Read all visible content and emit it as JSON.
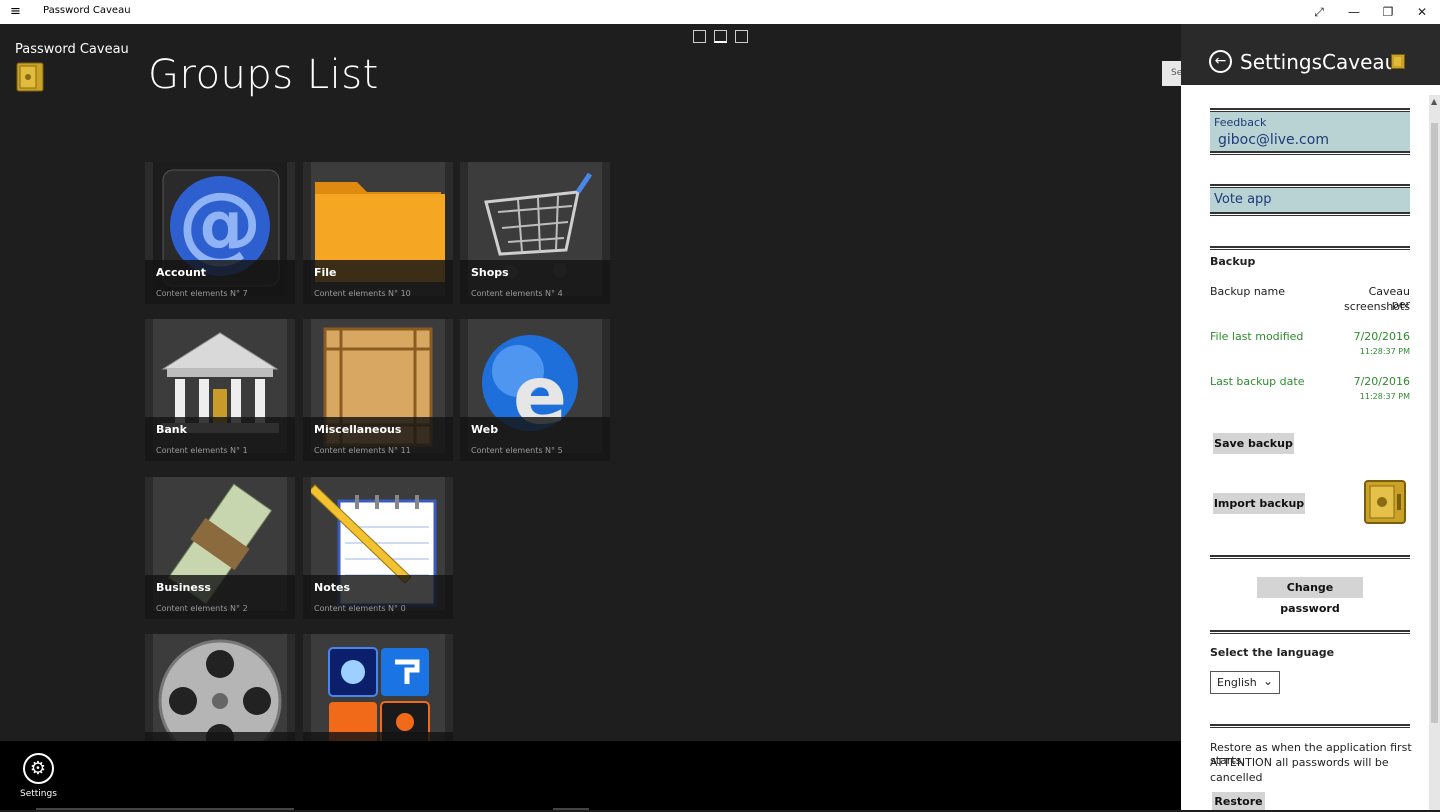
{
  "window": {
    "title": "Password Caveau",
    "menu_glyph": "≡",
    "controls": [
      "⤢",
      "—",
      "❐",
      "✕"
    ]
  },
  "app": {
    "name": "Password Caveau",
    "page_title": "Groups List",
    "search_stub": "Se"
  },
  "groups": [
    {
      "title": "Account",
      "subtitle": "Content elements N° 7",
      "icon": "at-sign-icon"
    },
    {
      "title": "File",
      "subtitle": "Content elements N° 10",
      "icon": "folder-icon"
    },
    {
      "title": "Shops",
      "subtitle": "Content elements N° 4",
      "icon": "shopping-cart-icon"
    },
    {
      "title": "Bank",
      "subtitle": "Content elements N° 1",
      "icon": "bank-building-icon"
    },
    {
      "title": "Miscellaneous",
      "subtitle": "Content elements N° 11",
      "icon": "wooden-crate-icon"
    },
    {
      "title": "Web",
      "subtitle": "Content elements N° 5",
      "icon": "internet-globe-icon"
    },
    {
      "title": "Business",
      "subtitle": "Content elements N° 2",
      "icon": "money-stack-icon"
    },
    {
      "title": "Notes",
      "subtitle": "Content elements N° 0",
      "icon": "notepad-pencil-icon"
    },
    {
      "title": "",
      "subtitle": "",
      "icon": "film-reel-icon"
    },
    {
      "title": "",
      "subtitle": "",
      "icon": "utilities-icon"
    }
  ],
  "appbar": {
    "settings_label": "Settings",
    "settings_icon": "gear-icon"
  },
  "settings": {
    "title": "SettingsCaveau",
    "back_icon": "back-arrow-icon",
    "feedback_label": "Feedback",
    "feedback_email": "giboc@live.com",
    "vote_label": "Vote app",
    "backup_heading": "Backup",
    "backup_name_label": "Backup name",
    "backup_name_value_1": "Caveau per",
    "backup_name_value_2": "screenshots",
    "file_modified_label": "File last modified",
    "file_modified_date": "7/20/2016",
    "file_modified_time": "11:28:37 PM",
    "last_backup_label": "Last backup date",
    "last_backup_date": "7/20/2016",
    "last_backup_time": "11:28:37 PM",
    "save_backup": "Save backup",
    "import_backup": "Import backup",
    "change_password": "Change password",
    "language_heading": "Select the language",
    "language_value": "English",
    "restore_text_1": "Restore as when the application first starts,",
    "restore_text_2": "ATTENTION all passwords will be",
    "restore_text_3": "cancelled",
    "restore_button": "Restore"
  },
  "colors": {
    "background": "#1e1e1e",
    "tile_caption": "#141414",
    "link_box": "#b9d3d5",
    "green_text": "#2e8b2e",
    "gold": "#c9a227"
  }
}
